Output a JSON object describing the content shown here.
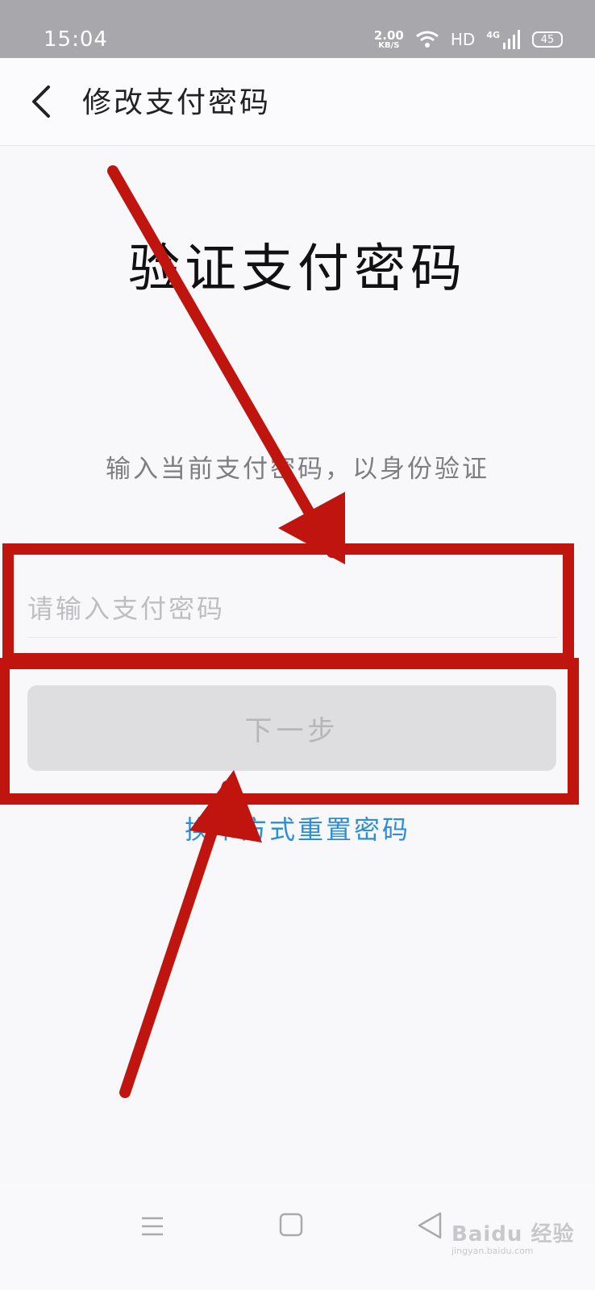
{
  "status_bar": {
    "time": "15:04",
    "net_speed_value": "2.00",
    "net_speed_unit": "KB/S",
    "hd_label": "HD",
    "network_label": "4G",
    "battery_level": "45",
    "icons": [
      "wifi-icon",
      "signal-icon",
      "battery-icon"
    ]
  },
  "header": {
    "back_icon": "chevron-left-icon",
    "title": "修改支付密码"
  },
  "main": {
    "title": "验证支付密码",
    "hint": "输入当前支付密码，以身份验证",
    "password_placeholder": "请输入支付密码",
    "password_value": "",
    "next_button": "下一步",
    "reset_link": "换个方式重置密码"
  },
  "annotation_color": "#c0140f",
  "system_nav": {
    "icons": [
      "menu-icon",
      "home-icon",
      "back-triangle-icon"
    ]
  },
  "watermark": {
    "brand": "Baidu 经验",
    "url": "jingyan.baidu.com"
  },
  "colors": {
    "status_bar": "#a8a7ab",
    "link": "#2a8fd8",
    "button_disabled": "#dedde0"
  }
}
